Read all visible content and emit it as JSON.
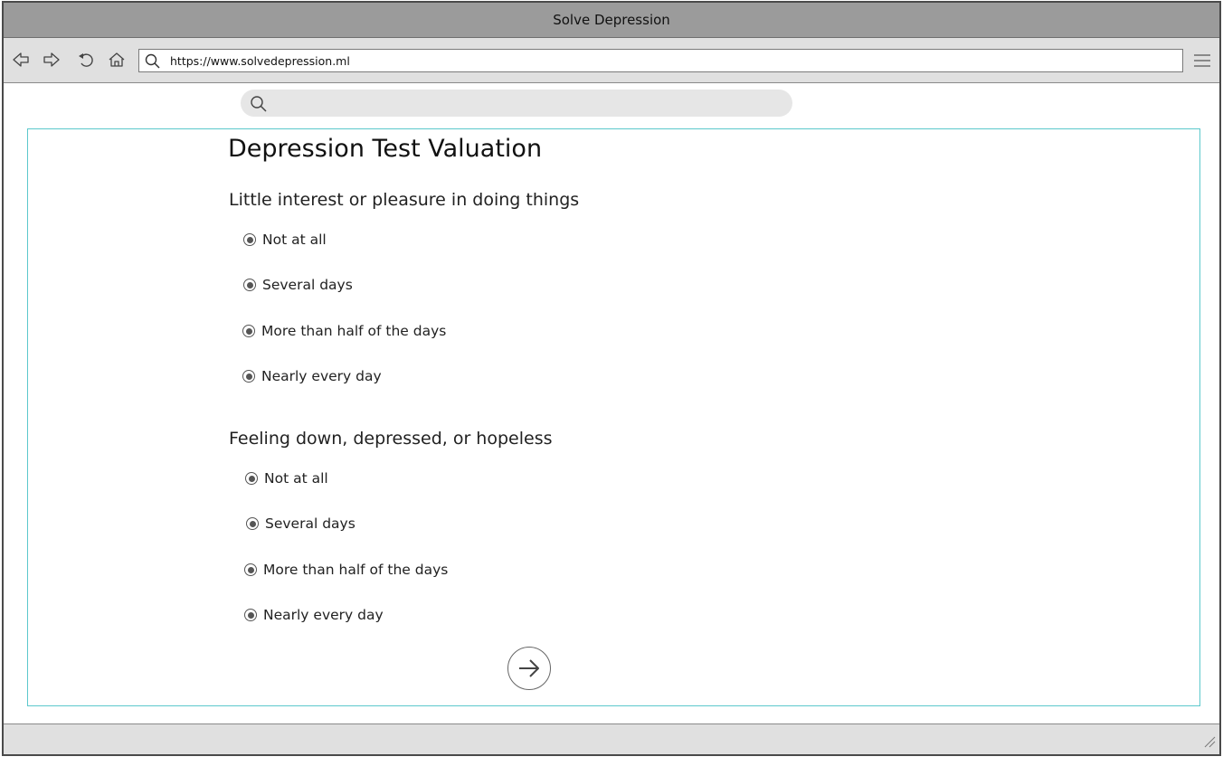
{
  "window": {
    "title": "Solve Depression"
  },
  "toolbar": {
    "url": "https://www.solvedepression.ml",
    "buttons": [
      "back-icon",
      "forward-icon",
      "reload-icon",
      "home-icon",
      "menu-icon"
    ]
  },
  "page": {
    "title": "Depression Test Valuation",
    "questions": [
      {
        "text": "Little interest or pleasure in doing things",
        "options": [
          "Not at all",
          "Several days",
          "More than half of the days",
          "Nearly every day"
        ]
      },
      {
        "text": "Feeling down, depressed, or hopeless",
        "options": [
          "Not at all",
          "Several days",
          "More than half of the days",
          "Nearly every day"
        ]
      }
    ],
    "next_icon": "arrow-right-icon"
  },
  "colors": {
    "titlebar": "#9b9b9b",
    "toolbar": "#e0e0e0",
    "panel_border": "#5cc8cc",
    "search_pill": "#e6e6e6"
  }
}
